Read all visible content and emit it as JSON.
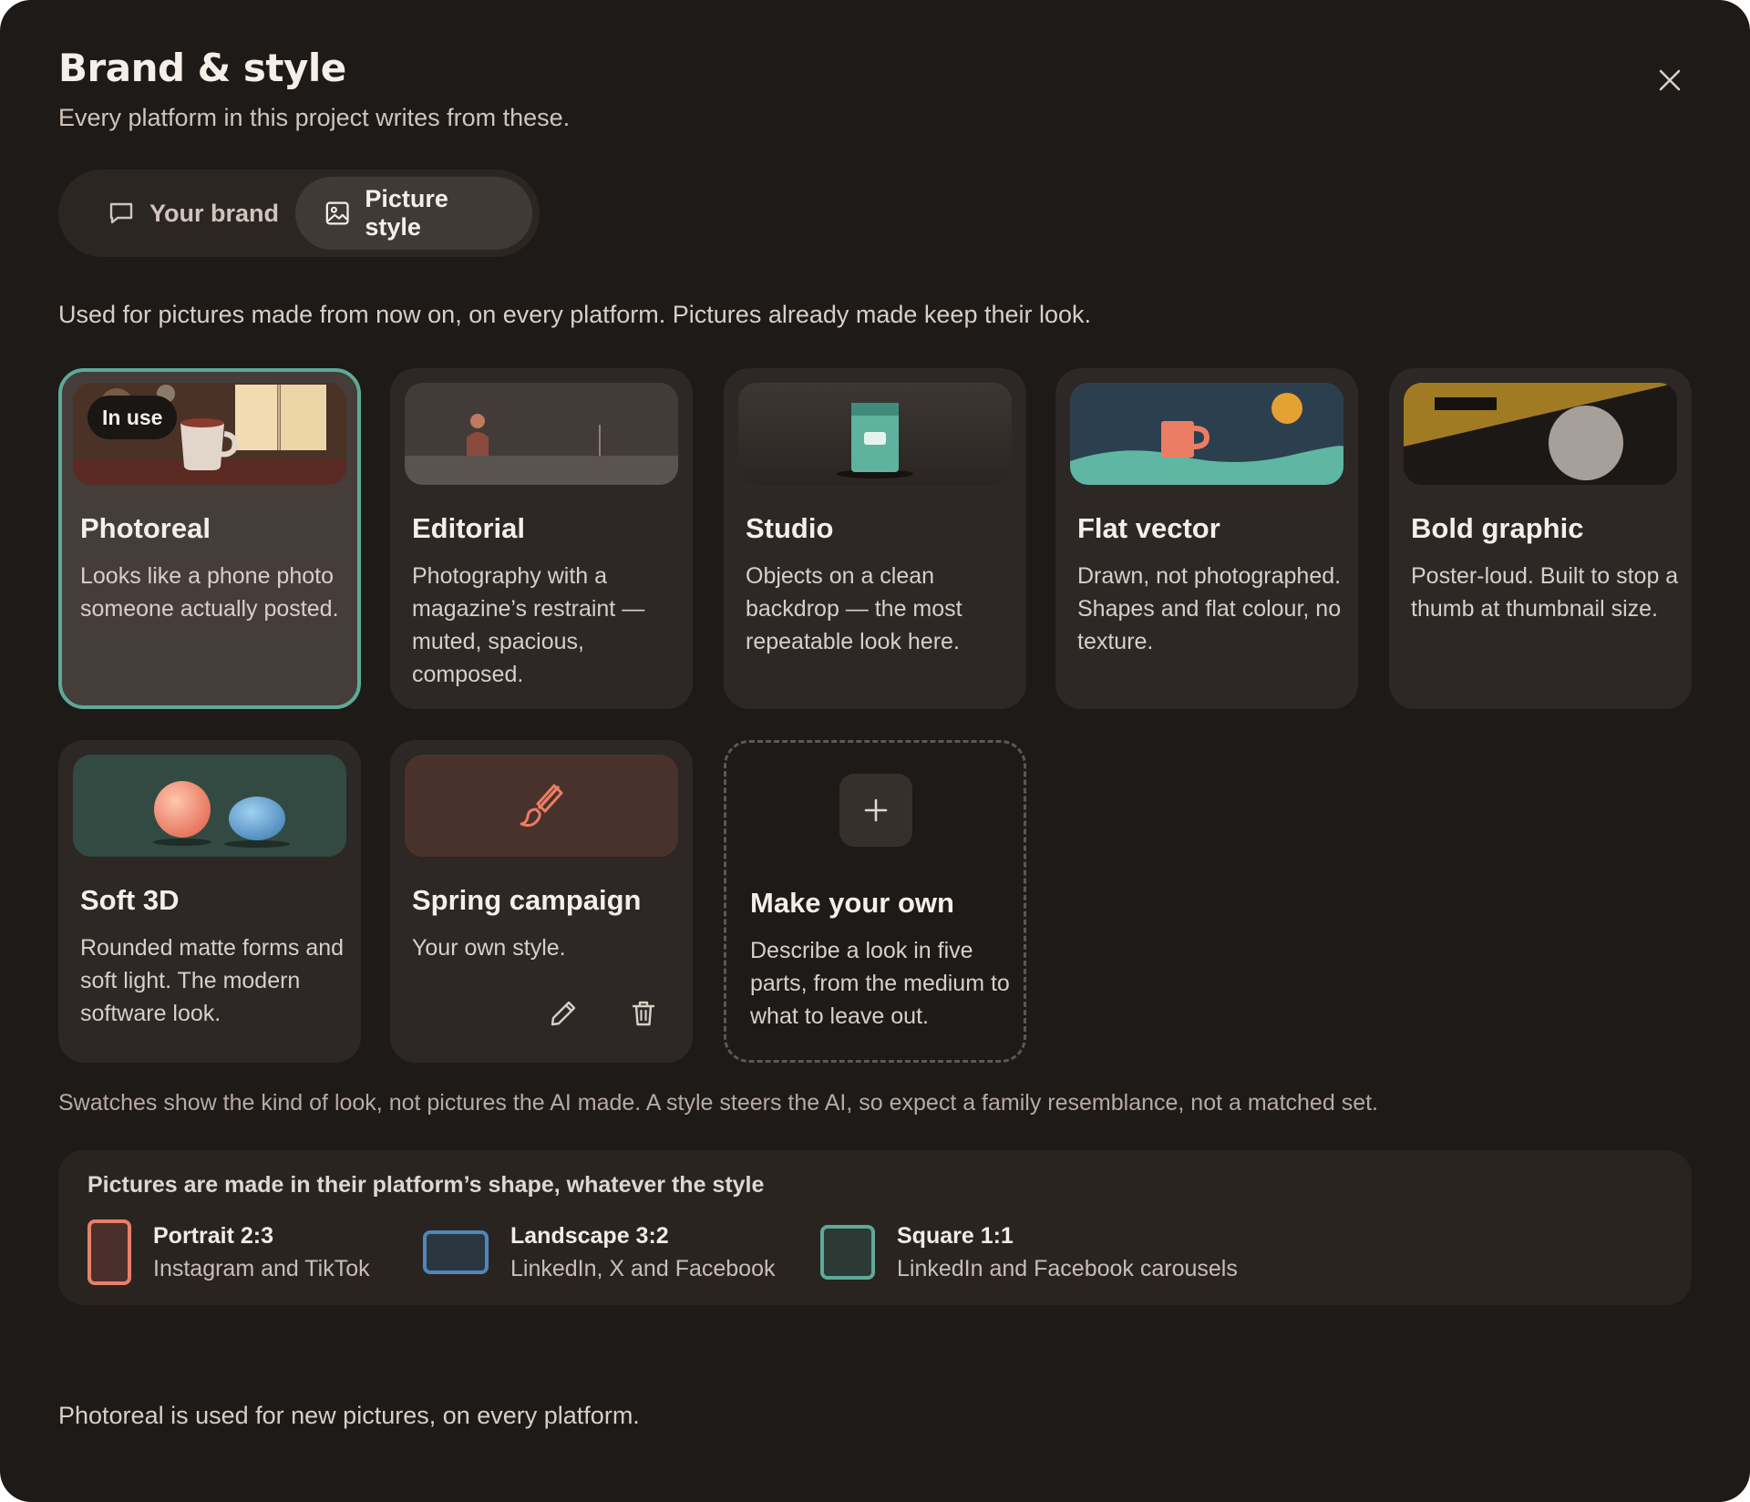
{
  "dialog": {
    "title": "Brand & style",
    "subtitle": "Every platform in this project writes from these.",
    "close_icon": "close-icon"
  },
  "tabs": [
    {
      "label": "Your brand",
      "icon": "speech-bubble-icon",
      "active": false
    },
    {
      "label": "Picture style",
      "icon": "image-icon",
      "active": true
    }
  ],
  "note": "Used for pictures made from now on, on every platform. Pictures already made keep their look.",
  "styles": [
    {
      "name": "Photoreal",
      "desc": "Looks like a phone photo someone actually posted.",
      "badge": "In use",
      "selected": true
    },
    {
      "name": "Editorial",
      "desc": "Photography with a magazine’s restraint — muted, spacious, composed.",
      "selected": false
    },
    {
      "name": "Studio",
      "desc": "Objects on a clean backdrop — the most repeatable look here.",
      "selected": false
    },
    {
      "name": "Flat vector",
      "desc": "Drawn, not photographed. Shapes and flat colour, no texture.",
      "selected": false
    },
    {
      "name": "Bold graphic",
      "desc": "Poster-loud. Built to stop a thumb at thumbnail size.",
      "selected": false
    },
    {
      "name": "Soft 3D",
      "desc": "Rounded matte forms and soft light. The modern software look.",
      "selected": false
    },
    {
      "name": "Spring campaign",
      "desc": "Your own style.",
      "custom": true,
      "icon": "paintbrush-icon",
      "edit_icon": "pencil-icon",
      "delete_icon": "trash-icon",
      "selected": false
    }
  ],
  "make_own": {
    "name": "Make your own",
    "desc": "Describe a look in five parts, from the medium to what to leave out.",
    "icon": "plus-icon"
  },
  "disclaimer": "Swatches show the kind of look, not pictures the AI made. A style steers the AI, so expect a family resemblance, not a matched set.",
  "shapes": {
    "title": "Pictures are made in their platform’s shape, whatever the style",
    "items": [
      {
        "label": "Portrait 2:3",
        "sub": "Instagram and TikTok",
        "color": "#e8806a"
      },
      {
        "label": "Landscape 3:2",
        "sub": "LinkedIn, X and Facebook",
        "color": "#4f87b8"
      },
      {
        "label": "Square 1:1",
        "sub": "LinkedIn and Facebook carousels",
        "color": "#5ea998"
      }
    ]
  },
  "footer": "Photoreal is used for new pictures, on every platform."
}
